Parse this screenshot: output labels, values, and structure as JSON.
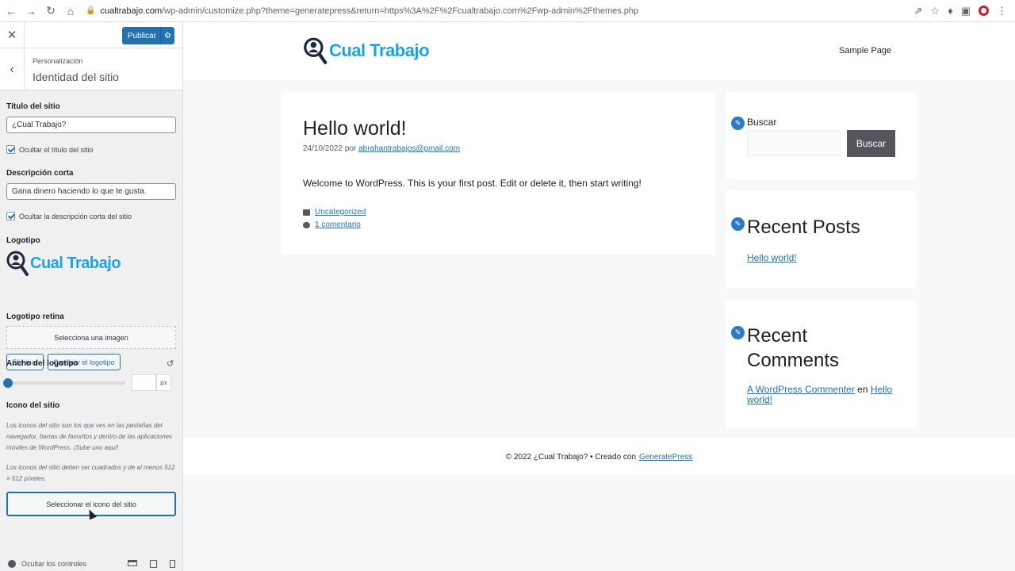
{
  "browser": {
    "url_host": "cualtrabajo.com",
    "url_path": "/wp-admin/customize.php?theme=generatepress&return=https%3A%2F%2Fcualtrabajo.com%2Fwp-admin%2Fthemes.php"
  },
  "sidebar": {
    "publish_label": "Publicar",
    "breadcrumb": "Personalización",
    "section_title": "Identidad del sitio",
    "site_title_label": "Título del sitio",
    "site_title_value": "¿Cual Trabajo?",
    "hide_title_label": "Ocultar el título del sitio",
    "tagline_label": "Descripción corta",
    "tagline_value": "Gana dinero haciendo lo que te gusta.",
    "hide_tagline_label": "Ocultar la descripción corta del sitio",
    "logo_label": "Logotipo",
    "logo_text": "Cual Trabajo",
    "remove_label": "Eliminar",
    "change_logo_label": "Cambiar el logotipo",
    "retina_label": "Logotipo retina",
    "select_image_label": "Selecciona una imagen",
    "logo_width_label": "Ancho del logotipo",
    "logo_width_unit": "px",
    "logo_width_fraction": 0,
    "site_icon_label": "Icono del sitio",
    "site_icon_desc_1": "Los iconos del sitio son los que ves en las pestañas del navegador, barras de favoritos y dentro de las aplicaciones móviles de WordPress. ¡Sube uno aquí!",
    "site_icon_desc_2": "Los iconos del sitio deben ser cuadrados y de al menos 512 × 512 píxeles.",
    "select_icon_label": "Seleccionar el icono del sitio",
    "hide_controls_label": "Ocultar los controles"
  },
  "preview": {
    "logo_text": "Cual Trabajo",
    "menu_item": "Sample Page",
    "post": {
      "title": "Hello world!",
      "date": "24/10/2022",
      "by": "por",
      "author": "abrahantrabajos@gmail.com",
      "body": "Welcome to WordPress. This is your first post. Edit or delete it, then start writing!",
      "category": "Uncategorized",
      "comments": "1 comentario"
    },
    "search_widget": {
      "label": "Buscar",
      "button": "Buscar"
    },
    "recent_posts": {
      "title": "Recent Posts",
      "item": "Hello world!"
    },
    "recent_comments": {
      "title_line1": "Recent",
      "title_line2": "Comments",
      "author": "A WordPress Commenter",
      "on": "en",
      "post_line1": "Hello",
      "post_line2": "world!"
    },
    "footer": {
      "copyright": "© 2022 ¿Cual Trabajo? • Creado con",
      "theme_link": "GeneratePress"
    }
  },
  "colors": {
    "accent": "#2271b1",
    "brand": "#1aa3e8",
    "button_dark": "#55555e"
  }
}
